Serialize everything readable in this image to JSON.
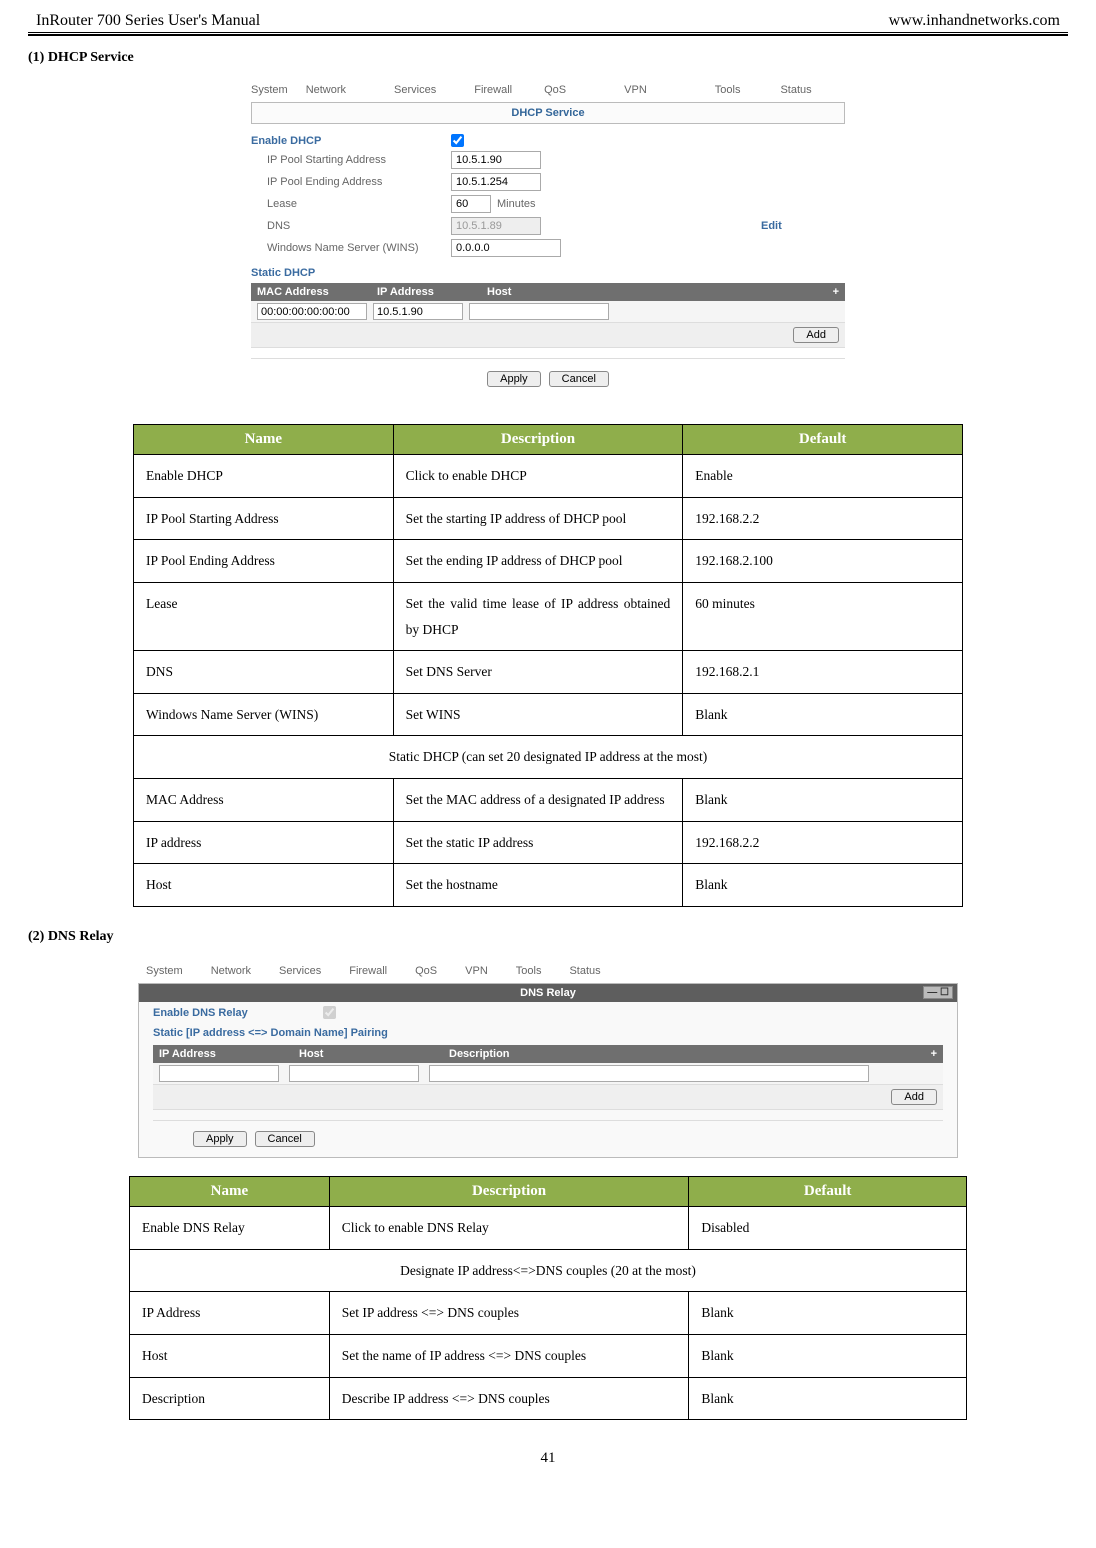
{
  "header": {
    "left": "InRouter 700 Series User's Manual",
    "right": "www.inhandnetworks.com"
  },
  "page_number": "41",
  "sections": {
    "s1_label": "(1)   DHCP Service",
    "s2_label": "(2)   DNS Relay"
  },
  "shot1": {
    "nav": {
      "system": "System",
      "network": "Network",
      "services": "Services",
      "firewall": "Firewall",
      "qos": "QoS",
      "vpn": "VPN",
      "tools": "Tools",
      "status": "Status"
    },
    "breadcrumb": "DHCP Service",
    "rows": {
      "enable_dhcp_label": "Enable DHCP",
      "ip_start_label": "IP Pool Starting Address",
      "ip_start_val": "10.5.1.90",
      "ip_end_label": "IP Pool Ending Address",
      "ip_end_val": "10.5.1.254",
      "lease_label": "Lease",
      "lease_val": "60",
      "lease_unit": "Minutes",
      "dns_label": "DNS",
      "dns_val": "10.5.1.89",
      "dns_edit": "Edit",
      "wins_label": "Windows Name Server (WINS)",
      "wins_val": "0.0.0.0"
    },
    "static_head": "Static DHCP",
    "tbl_hdr": {
      "mac": "MAC Address",
      "ip": "IP Address",
      "host": "Host",
      "plus": "+"
    },
    "tbl_row": {
      "mac_val": "00:00:00:00:00:00",
      "ip_val": "10.5.1.90",
      "host_val": ""
    },
    "add_btn": "Add",
    "apply": "Apply",
    "cancel": "Cancel"
  },
  "table1": {
    "headers": {
      "name": "Name",
      "desc": "Description",
      "default": "Default"
    },
    "rows": [
      {
        "n": "Enable DHCP",
        "d": "Click to enable DHCP",
        "f": "Enable"
      },
      {
        "n": "IP Pool Starting Address",
        "d": "Set the starting IP address of DHCP pool",
        "f": "192.168.2.2"
      },
      {
        "n": "IP Pool Ending Address",
        "d": "Set the ending IP address of DHCP pool",
        "f": "192.168.2.100"
      },
      {
        "n": "Lease",
        "d": "Set the valid time lease of IP address obtained by DHCP",
        "f": "60 minutes"
      },
      {
        "n": "DNS",
        "d": "Set DNS Server",
        "f": "192.168.2.1"
      },
      {
        "n": "Windows Name Server (WINS)",
        "d": "Set WINS",
        "f": "Blank"
      }
    ],
    "span_row": "Static DHCP (can set 20 designated IP address at the most)",
    "rows2": [
      {
        "n": "MAC Address",
        "d": "Set the MAC address of a designated IP address",
        "f": "Blank"
      },
      {
        "n": "IP address",
        "d": "Set the static IP address",
        "f": "192.168.2.2"
      },
      {
        "n": "Host",
        "d": "Set the hostname",
        "f": "Blank"
      }
    ]
  },
  "shot2": {
    "nav": {
      "system": "System",
      "network": "Network",
      "services": "Services",
      "firewall": "Firewall",
      "qos": "QoS",
      "vpn": "VPN",
      "tools": "Tools",
      "status": "Status"
    },
    "breadcrumb": "DNS Relay",
    "wincontrols": "— ☐",
    "enable_label": "Enable DNS Relay",
    "static_head": "Static [IP address <=> Domain Name] Pairing",
    "tbl_hdr": {
      "ip": "IP Address",
      "host": "Host",
      "desc": "Description",
      "plus": "+"
    },
    "add_btn": "Add",
    "apply": "Apply",
    "cancel": "Cancel"
  },
  "table2": {
    "headers": {
      "name": "Name",
      "desc": "Description",
      "default": "Default"
    },
    "rows": [
      {
        "n": "Enable DNS Relay",
        "d": "Click to enable DNS Relay",
        "f": "Disabled"
      }
    ],
    "span_row": "Designate IP address<=>DNS couples (20 at the most)",
    "rows2": [
      {
        "n": "IP Address",
        "d": "Set IP address <=> DNS couples",
        "f": "Blank"
      },
      {
        "n": "Host",
        "d": "Set the name of IP address <=> DNS couples",
        "f": "Blank"
      },
      {
        "n": "Description",
        "d": "Describe IP address <=> DNS couples",
        "f": "Blank"
      }
    ]
  }
}
